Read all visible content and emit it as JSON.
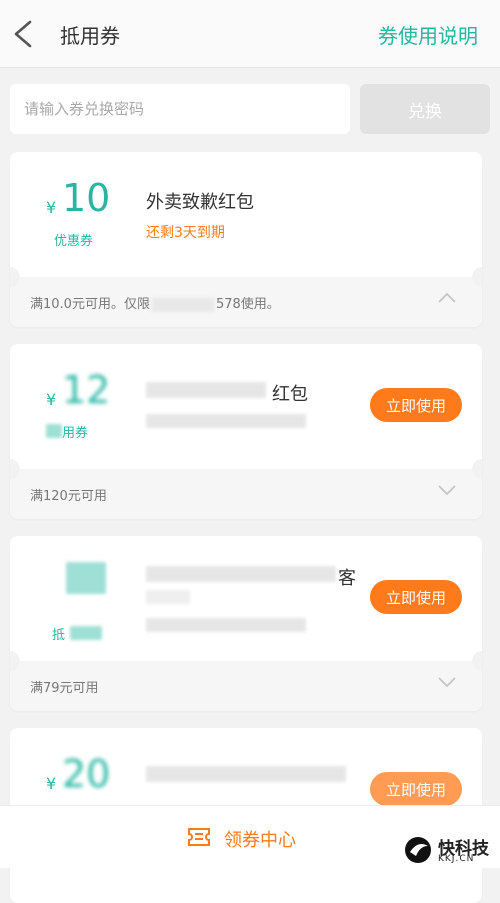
{
  "header": {
    "title": "抵用券",
    "help_link": "券使用说明"
  },
  "redeem": {
    "placeholder": "请输入券兑换密码",
    "button": "兑换"
  },
  "coupons": [
    {
      "currency": "¥",
      "amount": "10",
      "type": "优惠券",
      "title": "外卖致歉红包",
      "expiry": "还剩3天到期",
      "condition": "满10.0元可用。仅限",
      "condition_tail": "578使用。",
      "expanded": true
    },
    {
      "currency": "¥",
      "amount": "12",
      "type": "用券",
      "title_tail": "红包",
      "action": "立即使用",
      "condition": "满120元可用"
    },
    {
      "title_tail": "客",
      "type": "抵",
      "action": "立即使用",
      "condition": "满79元可用"
    },
    {
      "currency": "¥",
      "amount": "20",
      "action": "立即使用"
    }
  ],
  "bottom_nav": {
    "label": "领券中心"
  },
  "watermark": {
    "text": "快科技",
    "sub": "KKJ.CN"
  },
  "colors": {
    "accent": "#26b7a2",
    "action": "#ff7a1a",
    "background": "#f2f2f2"
  }
}
